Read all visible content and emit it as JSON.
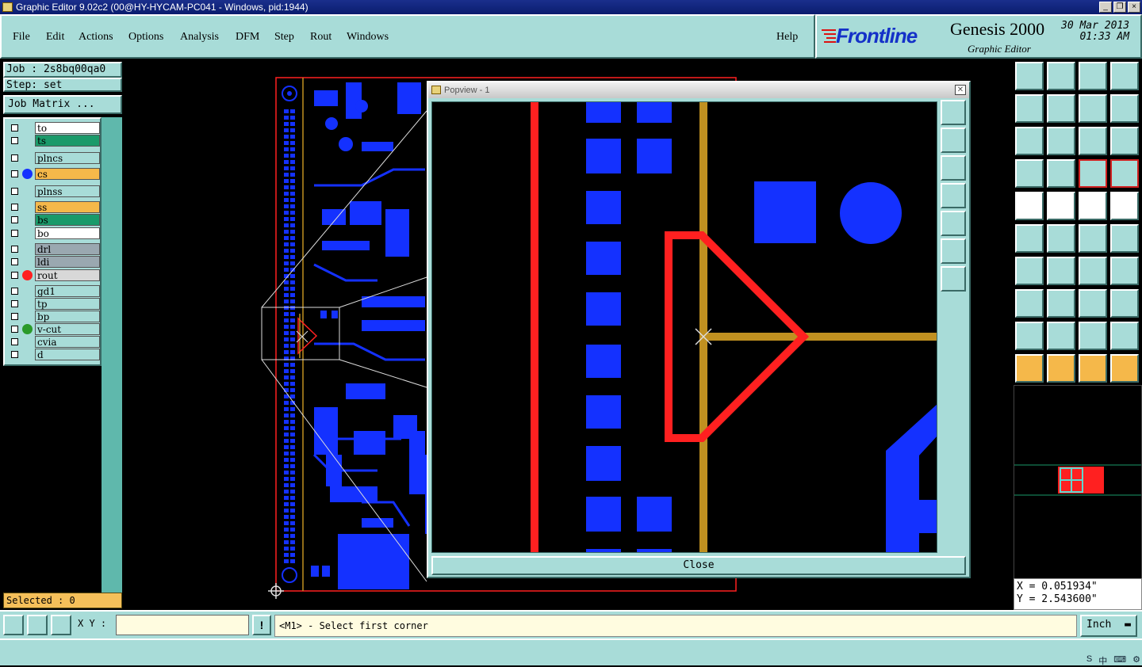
{
  "window": {
    "title": "Graphic Editor 9.02c2 (00@HY-HYCAM-PC041 - Windows, pid:1944)"
  },
  "menu": {
    "items": [
      {
        "label": "File",
        "name": "menu-file"
      },
      {
        "label": "Edit",
        "name": "menu-edit"
      },
      {
        "label": "Actions",
        "name": "menu-actions"
      },
      {
        "label": "Options",
        "name": "menu-options"
      },
      {
        "label": "Analysis",
        "name": "menu-analysis"
      },
      {
        "label": "DFM",
        "name": "menu-dfm"
      },
      {
        "label": "Step",
        "name": "menu-step"
      },
      {
        "label": "Rout",
        "name": "menu-rout"
      },
      {
        "label": "Windows",
        "name": "menu-windows"
      }
    ],
    "help": "Help"
  },
  "brand": {
    "logo": "Frontline",
    "product": "Genesis 2000",
    "subtitle": "Graphic Editor",
    "date": "30 Mar 2013",
    "time": "01:33 AM"
  },
  "job": {
    "job_label": "Job : 2s8bq00qa0",
    "step_label": "Step: set",
    "matrix_button": "Job Matrix ..."
  },
  "layers": [
    {
      "name": "to",
      "color": "#ffffff",
      "dot": ""
    },
    {
      "name": "ts",
      "color": "#1a9a6a",
      "dot": ""
    },
    {
      "name": "plncs",
      "color": "#a8dcd8",
      "dot": ""
    },
    {
      "name": "cs",
      "color": "#f5b84a",
      "dot": "#1431ff"
    },
    {
      "name": "plnss",
      "color": "#a8dcd8",
      "dot": ""
    },
    {
      "name": "ss",
      "color": "#f5b84a",
      "dot": ""
    },
    {
      "name": "bs",
      "color": "#1a9a6a",
      "dot": ""
    },
    {
      "name": "bo",
      "color": "#ffffff",
      "dot": ""
    },
    {
      "name": "drl",
      "color": "#9aa8b0",
      "dot": ""
    },
    {
      "name": "ldi",
      "color": "#9aa8b0",
      "dot": ""
    },
    {
      "name": "rout",
      "color": "#d8d8d8",
      "dot": "#ff2020"
    },
    {
      "name": "gd1",
      "color": "#a8dcd8",
      "dot": ""
    },
    {
      "name": "tp",
      "color": "#a8dcd8",
      "dot": ""
    },
    {
      "name": "bp",
      "color": "#a8dcd8",
      "dot": ""
    },
    {
      "name": "v-cut",
      "color": "#a8dcd8",
      "dot": "#2a9a2a"
    },
    {
      "name": "cvia",
      "color": "#a8dcd8",
      "dot": ""
    },
    {
      "name": "d",
      "color": "#a8dcd8",
      "dot": ""
    }
  ],
  "selected": "Selected : 0",
  "popview": {
    "title": "Popview - 1",
    "close_label": "Close"
  },
  "coords": {
    "x": "X = 0.051934\"",
    "y": "Y = 2.543600\""
  },
  "bottom": {
    "xy_label": "X Y :",
    "xy_value": "",
    "message": "<M1> - Select first corner",
    "unit": "Inch"
  },
  "colors": {
    "panel": "#a8dcd8",
    "copper": "#1431ff",
    "rout": "#ff2020",
    "profile": "#c09020"
  }
}
